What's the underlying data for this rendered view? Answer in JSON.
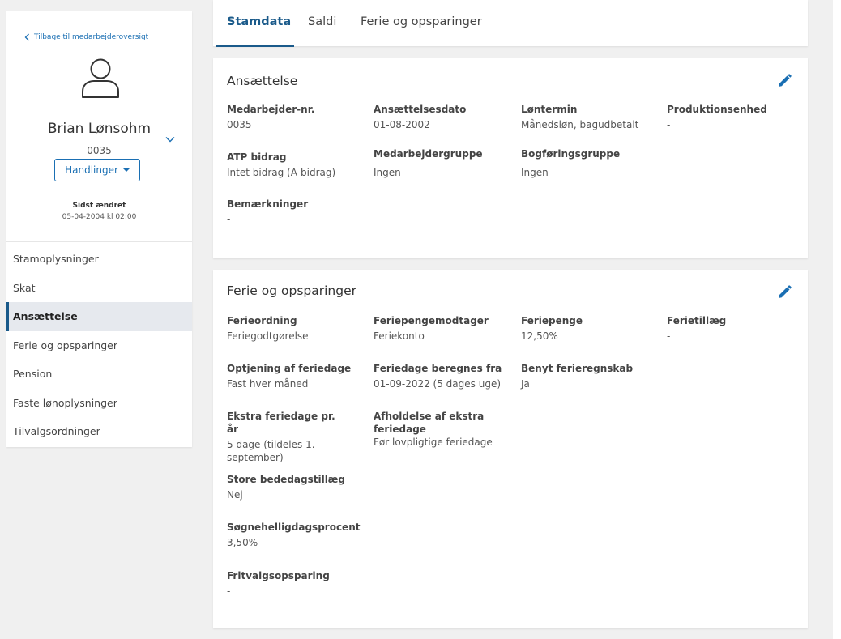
{
  "sidebar": {
    "back_link": "Tilbage til medarbejderoversigt",
    "employee_name": "Brian Lønsohm",
    "employee_number": "0035",
    "actions_button": "Handlinger",
    "last_changed_label": "Sidst ændret",
    "last_changed_value": "05-04-2004 kl 02:00",
    "nav": [
      {
        "label": "Stamoplysninger"
      },
      {
        "label": "Skat"
      },
      {
        "label": "Ansættelse"
      },
      {
        "label": "Ferie og opsparinger"
      },
      {
        "label": "Pension"
      },
      {
        "label": "Faste lønoplysninger"
      },
      {
        "label": "Tilvalgsordninger"
      }
    ],
    "active_nav": "Ansættelse"
  },
  "tabs": [
    {
      "label": "Stamdata"
    },
    {
      "label": "Saldi"
    },
    {
      "label": "Ferie og opsparinger"
    }
  ],
  "active_tab": "Stamdata",
  "employment": {
    "title": "Ansættelse",
    "fields": [
      {
        "label": "Medarbejder-nr.",
        "value": "0035"
      },
      {
        "label": "Ansættelsesdato",
        "value": "01-08-2002"
      },
      {
        "label": "Løntermin",
        "value": "Månedsløn, bagudbetalt"
      },
      {
        "label": "Produktionsenhed",
        "value": "-"
      },
      {
        "label": "ATP bidrag",
        "value": "Intet bidrag (A-bidrag)"
      },
      {
        "label": "Medarbejdergruppe",
        "value": "Ingen"
      },
      {
        "label": "Bogføringsgruppe",
        "value": "Ingen"
      },
      {
        "label": "Bemærkninger",
        "value": "-"
      }
    ]
  },
  "holiday": {
    "title": "Ferie og opsparinger",
    "fields": [
      {
        "label": "Ferieordning",
        "value": "Feriegodtgørelse"
      },
      {
        "label": "Feriepengemodtager",
        "value": "Feriekonto"
      },
      {
        "label": "Feriepenge",
        "value": "12,50%"
      },
      {
        "label": "Ferietillæg",
        "value": "-"
      },
      {
        "label": "Optjening af feriedage",
        "value": "Fast hver måned"
      },
      {
        "label": "Feriedage beregnes fra",
        "value": "01-09-2022 (5 dages uge)"
      },
      {
        "label": "Benyt ferieregnskab",
        "value": "Ja"
      },
      {
        "label": "Ekstra feriedage pr. år",
        "value": "5 dage (tildeles 1. september)"
      },
      {
        "label": "Afholdelse af ekstra feriedage",
        "value": "Før lovpligtige feriedage"
      },
      {
        "label": "Store bededagstillæg",
        "value": "Nej"
      },
      {
        "label": "Søgnehelligdagsprocent",
        "value": "3,50%"
      },
      {
        "label": "Fritvalgsopsparing",
        "value": "-"
      }
    ]
  },
  "colors": {
    "accent": "#1a6fb3",
    "tab_active": "#1a5a8a",
    "background": "#f0f0f0"
  },
  "icons": {
    "back": "chevron-left-icon",
    "avatar": "user-icon",
    "expand": "chevron-down-icon",
    "dropdown": "caret-down-icon",
    "edit": "pencil-icon"
  }
}
